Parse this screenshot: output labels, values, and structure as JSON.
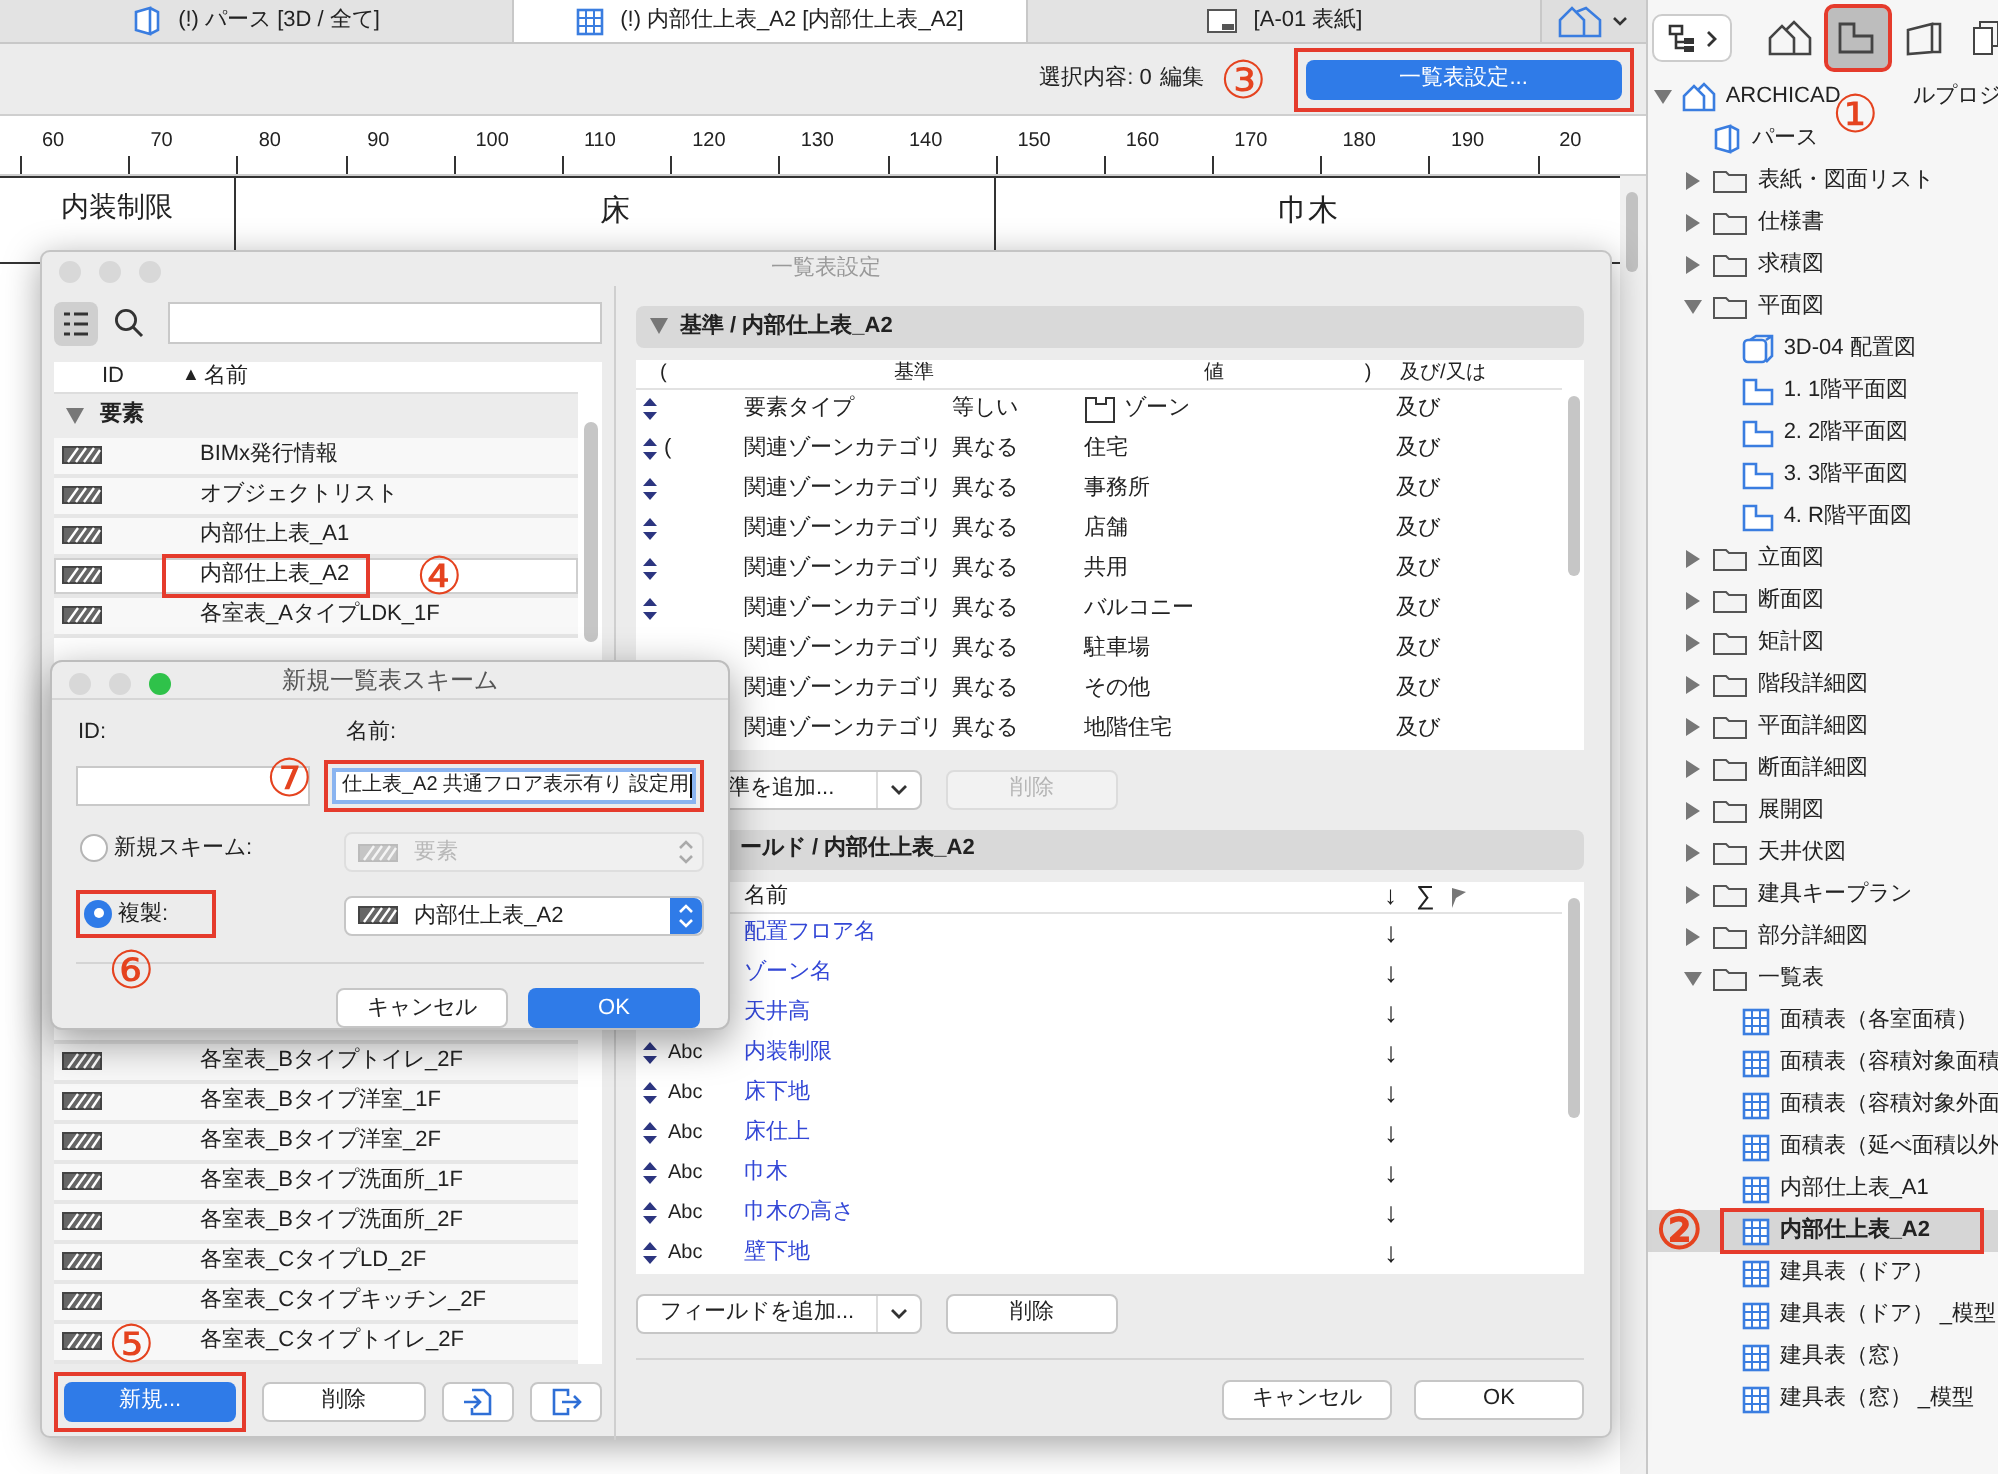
{
  "tabs": [
    {
      "label": "(!) パース [3D / 全て]",
      "selected": false
    },
    {
      "label": "(!) 内部仕上表_A2 [内部仕上表_A2]",
      "selected": true
    },
    {
      "label": "[A-01 表紙]",
      "selected": false
    }
  ],
  "toolbar": {
    "selection": "選択内容: 0",
    "edit": "編集",
    "callout": "③",
    "settings_button": {
      "label": "一覧表設定...",
      "highlighted": true
    }
  },
  "ruler": [
    "60",
    "70",
    "80",
    "90",
    "100",
    "110",
    "120",
    "130",
    "140",
    "150",
    "160",
    "170",
    "180",
    "190",
    "20"
  ],
  "sheet": {
    "headers": [
      "内装制限",
      "床",
      "巾木"
    ]
  },
  "schedule_settings": {
    "title": "一覧表設定",
    "list": {
      "columns": [
        "ID",
        "名前"
      ],
      "sort_indicator": "▲",
      "group": "要素",
      "group_expanded": true,
      "items": [
        {
          "name": "BIMx発行情報",
          "selected": false,
          "highlighted": false
        },
        {
          "name": "オブジェクトリスト",
          "selected": false,
          "highlighted": false
        },
        {
          "name": "内部仕上表_A1",
          "selected": false,
          "highlighted": false
        },
        {
          "name": "内部仕上表_A2",
          "selected": true,
          "highlighted": true,
          "callout": "④"
        },
        {
          "name": "各室表_AタイプLDK_1F",
          "selected": false,
          "highlighted": false
        }
      ],
      "more_items": [
        {
          "name": "各室表_Bタイプトイレ_2F",
          "selected": false,
          "highlighted": false
        },
        {
          "name": "各室表_Bタイプ洋室_1F",
          "selected": false,
          "highlighted": false
        },
        {
          "name": "各室表_Bタイプ洋室_2F",
          "selected": false,
          "highlighted": false
        },
        {
          "name": "各室表_Bタイプ洗面所_1F",
          "selected": false,
          "highlighted": false
        },
        {
          "name": "各室表_Bタイプ洗面所_2F",
          "selected": false,
          "highlighted": false
        },
        {
          "name": "各室表_CタイプLD_2F",
          "selected": false,
          "highlighted": false
        },
        {
          "name": "各室表_Cタイプキッチン_2F",
          "selected": false,
          "highlighted": false
        },
        {
          "name": "各室表_Cタイプトイレ_2F",
          "selected": false,
          "highlighted": false,
          "callout": "⑤"
        }
      ],
      "new_button": {
        "label": "新規...",
        "highlighted": true
      },
      "delete_button": "削除"
    },
    "criteria": {
      "title": "基準 / 内部仕上表_A2",
      "expanded": true,
      "columns": [
        "(",
        "基準",
        "値",
        ")",
        "及び/又は"
      ],
      "rows": [
        {
          "handle": true,
          "open": "",
          "criterion": "要素タイプ",
          "operator": "等しい",
          "value": "ゾーン",
          "value_icon": true,
          "conj": "及び"
        },
        {
          "handle": true,
          "open": "(",
          "criterion": "関連ゾーンカテゴリ",
          "operator": "異なる",
          "value": "住宅",
          "value_icon": false,
          "conj": "及び"
        },
        {
          "handle": true,
          "open": "",
          "criterion": "関連ゾーンカテゴリ",
          "operator": "異なる",
          "value": "事務所",
          "value_icon": false,
          "conj": "及び"
        },
        {
          "handle": true,
          "open": "",
          "criterion": "関連ゾーンカテゴリ",
          "operator": "異なる",
          "value": "店舗",
          "value_icon": false,
          "conj": "及び"
        },
        {
          "handle": true,
          "open": "",
          "criterion": "関連ゾーンカテゴリ",
          "operator": "異なる",
          "value": "共用",
          "value_icon": false,
          "conj": "及び"
        },
        {
          "handle": true,
          "open": "",
          "criterion": "関連ゾーンカテゴリ",
          "operator": "異なる",
          "value": "バルコニー",
          "value_icon": false,
          "conj": "及び"
        },
        {
          "handle": false,
          "open": "",
          "criterion": "関連ゾーンカテゴリ",
          "operator": "異なる",
          "value": "駐車場",
          "value_icon": false,
          "conj": "及び"
        },
        {
          "handle": false,
          "open": "",
          "criterion": "関連ゾーンカテゴリ",
          "operator": "異なる",
          "value": "その他",
          "value_icon": false,
          "conj": "及び"
        },
        {
          "handle": false,
          "open": "",
          "criterion": "関連ゾーンカテゴリ",
          "operator": "異なる",
          "value": "地階住宅",
          "value_icon": false,
          "conj": "及び"
        }
      ],
      "add_button": "準を追加...",
      "delete_button": {
        "label": "削除",
        "disabled": true
      }
    },
    "fields": {
      "title": "ールド / 内部仕上表_A2",
      "columns": [
        "名前",
        "↓",
        "∑"
      ],
      "rows": [
        {
          "handle": false,
          "type_label": "",
          "name": "配置フロア名",
          "sort": "↓"
        },
        {
          "handle": false,
          "type_label": "",
          "name": "ゾーン名",
          "sort": "↓"
        },
        {
          "handle": false,
          "type_label": "",
          "name": "天井高",
          "sort": "↓"
        },
        {
          "handle": true,
          "type_label": "Abc",
          "name": "内装制限",
          "sort": "↓"
        },
        {
          "handle": true,
          "type_label": "Abc",
          "name": "床下地",
          "sort": "↓"
        },
        {
          "handle": true,
          "type_label": "Abc",
          "name": "床仕上",
          "sort": "↓"
        },
        {
          "handle": true,
          "type_label": "Abc",
          "name": "巾木",
          "sort": "↓"
        },
        {
          "handle": true,
          "type_label": "Abc",
          "name": "巾木の高さ",
          "sort": "↓"
        },
        {
          "handle": true,
          "type_label": "Abc",
          "name": "壁下地",
          "sort": "↓"
        }
      ],
      "add_button": "フィールドを追加...",
      "delete_button": {
        "label": "削除",
        "disabled": false
      }
    },
    "cancel": "キャンセル",
    "ok": "OK"
  },
  "new_scheme": {
    "title": "新規一覧表スキーム",
    "id_label": "ID:",
    "name_label": "名前:",
    "name_value": "仕上表_A2 共通フロア表示有り 設定用",
    "name_highlighted": true,
    "name_callout": "⑦",
    "options": [
      {
        "label": "新規スキーム:",
        "selected": false,
        "highlighted": false,
        "select": "要素",
        "disabled": true
      },
      {
        "label": "複製:",
        "selected": true,
        "highlighted": true,
        "select": "内部仕上表_A2",
        "disabled": false,
        "callout": "⑥"
      }
    ],
    "cancel": "キャンセル",
    "ok": "OK"
  },
  "navigator": {
    "tabs": [
      {
        "selected": false,
        "highlighted": false
      },
      {
        "selected": true,
        "highlighted": true
      },
      {
        "selected": false,
        "highlighted": false
      },
      {
        "selected": false,
        "highlighted": false
      }
    ],
    "tree": [
      {
        "label": "ARCHICAD",
        "label_rest": "ルプロジ",
        "callout": "①",
        "kind": "project",
        "selected": false,
        "expanded": true,
        "children": [
          {
            "label": "パース",
            "kind": "perspective",
            "selected": false
          },
          {
            "label": "表紙・図面リスト",
            "kind": "folder",
            "selected": false,
            "expanded": false
          },
          {
            "label": "仕様書",
            "kind": "folder",
            "selected": false,
            "expanded": false
          },
          {
            "label": "求積図",
            "kind": "folder",
            "selected": false,
            "expanded": false
          },
          {
            "label": "平面図",
            "kind": "folder",
            "selected": false,
            "expanded": true,
            "children": [
              {
                "label": "3D-04 配置図",
                "kind": "model",
                "selected": false
              },
              {
                "label": "1. 1階平面図",
                "kind": "plan",
                "selected": false
              },
              {
                "label": "2. 2階平面図",
                "kind": "plan",
                "selected": false
              },
              {
                "label": "3. 3階平面図",
                "kind": "plan",
                "selected": false
              },
              {
                "label": "4. R階平面図",
                "kind": "plan",
                "selected": false
              }
            ]
          },
          {
            "label": "立面図",
            "kind": "folder",
            "selected": false,
            "expanded": false
          },
          {
            "label": "断面図",
            "kind": "folder",
            "selected": false,
            "expanded": false
          },
          {
            "label": "矩計図",
            "kind": "folder",
            "selected": false,
            "expanded": false
          },
          {
            "label": "階段詳細図",
            "kind": "folder",
            "selected": false,
            "expanded": false
          },
          {
            "label": "平面詳細図",
            "kind": "folder",
            "selected": false,
            "expanded": false
          },
          {
            "label": "断面詳細図",
            "kind": "folder",
            "selected": false,
            "expanded": false
          },
          {
            "label": "展開図",
            "kind": "folder",
            "selected": false,
            "expanded": false
          },
          {
            "label": "天井伏図",
            "kind": "folder",
            "selected": false,
            "expanded": false
          },
          {
            "label": "建具キープラン",
            "kind": "folder",
            "selected": false,
            "expanded": false
          },
          {
            "label": "部分詳細図",
            "kind": "folder",
            "selected": false,
            "expanded": false
          },
          {
            "label": "一覧表",
            "kind": "folder",
            "selected": false,
            "expanded": true,
            "children": [
              {
                "label": "面積表（各室面積）",
                "kind": "schedule",
                "selected": false
              },
              {
                "label": "面積表（容積対象面積",
                "kind": "schedule",
                "selected": false
              },
              {
                "label": "面積表（容積対象外面",
                "kind": "schedule",
                "selected": false
              },
              {
                "label": "面積表（延べ面積以外",
                "kind": "schedule",
                "selected": false
              },
              {
                "label": "内部仕上表_A1",
                "kind": "schedule",
                "selected": false
              },
              {
                "label": "内部仕上表_A2",
                "kind": "schedule",
                "selected": true,
                "highlighted": true,
                "callout": "②"
              },
              {
                "label": "建具表（ドア）",
                "kind": "schedule",
                "selected": false
              },
              {
                "label": "建具表（ドア） _模型",
                "kind": "schedule",
                "selected": false
              },
              {
                "label": "建具表（窓）",
                "kind": "schedule",
                "selected": false
              },
              {
                "label": "建具表（窓） _模型",
                "kind": "schedule",
                "selected": false
              }
            ]
          }
        ]
      }
    ]
  }
}
